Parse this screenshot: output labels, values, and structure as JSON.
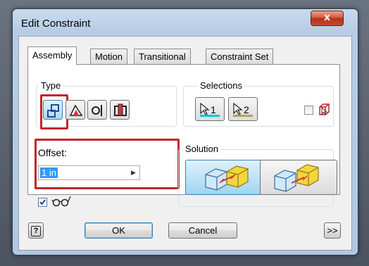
{
  "window": {
    "title": "Edit Constraint",
    "close_label": "x"
  },
  "tabs": [
    {
      "label": "Assembly",
      "active": true
    },
    {
      "label": "Motion",
      "active": false
    },
    {
      "label": "Transitional",
      "active": false
    },
    {
      "label": "Constraint Set",
      "active": false
    }
  ],
  "type_group": {
    "label": "Type",
    "buttons": [
      {
        "icon": "mate-constraint-icon",
        "selected": true
      },
      {
        "icon": "angle-constraint-icon",
        "selected": false
      },
      {
        "icon": "tangent-constraint-icon",
        "selected": false
      },
      {
        "icon": "insert-constraint-icon",
        "selected": false
      }
    ]
  },
  "selections_group": {
    "label": "Selections",
    "first": {
      "number": "1",
      "icon": "select-arrow-icon",
      "underline_color": "#00c8d4"
    },
    "second": {
      "number": "2",
      "icon": "select-arrow-icon",
      "underline_color": "#b7a24a"
    },
    "pick_part_first": {
      "checked": false,
      "icon": "pick-part-first-icon"
    }
  },
  "offset": {
    "label": "Offset:",
    "value": "1 in"
  },
  "solution_group": {
    "label": "Solution",
    "options": [
      {
        "name": "mate",
        "icon": "mate-solution-icon",
        "selected": true
      },
      {
        "name": "flush",
        "icon": "flush-solution-icon",
        "selected": false
      }
    ]
  },
  "show_preview": {
    "checked": true,
    "icon": "glasses-icon"
  },
  "footer": {
    "help_label": "?",
    "ok_label": "OK",
    "cancel_label": "Cancel",
    "more_label": ">>"
  },
  "colors": {
    "highlight_red": "#c0262c",
    "selection_blue": "#3399ff"
  }
}
